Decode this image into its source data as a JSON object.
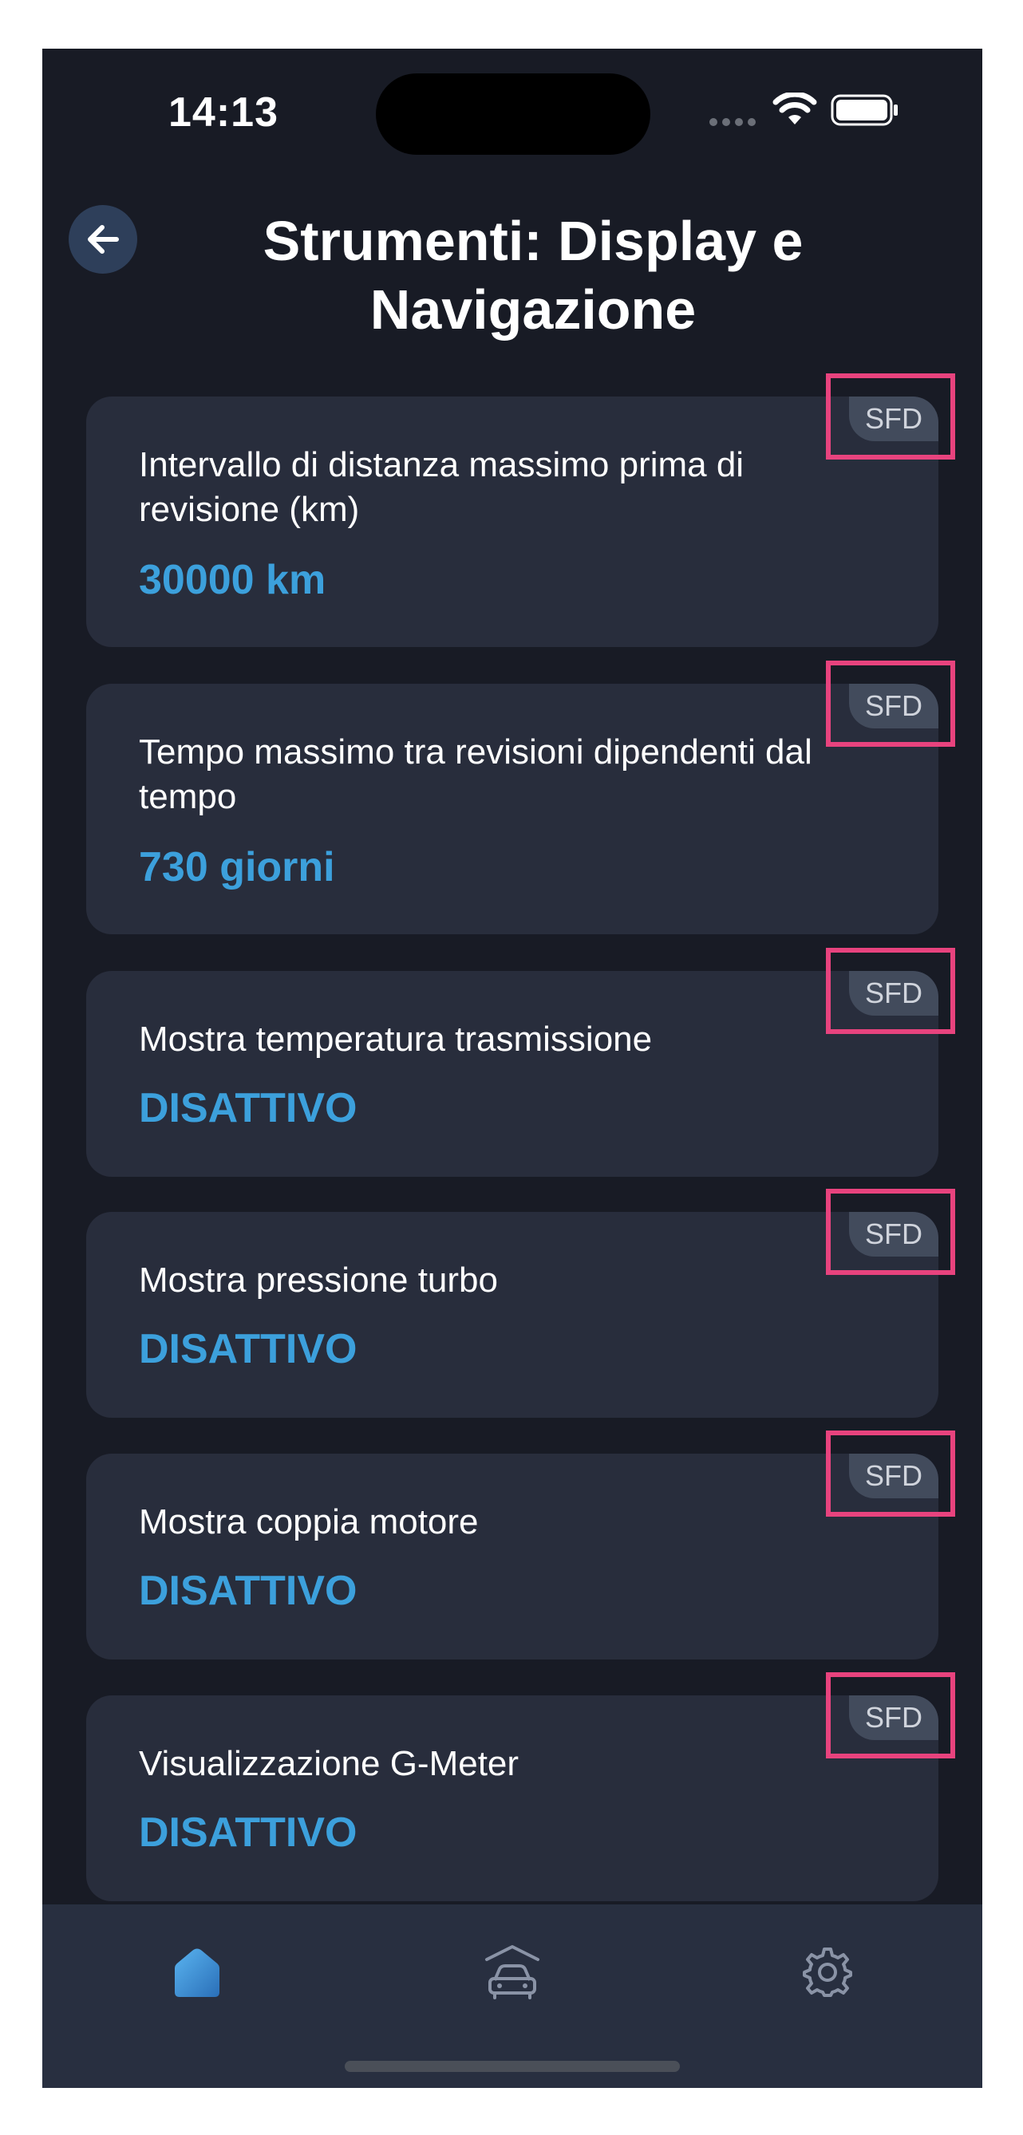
{
  "status_bar": {
    "time": "14:13"
  },
  "header": {
    "title": "Strumenti: Display e Navigazione",
    "back_icon": "arrow-left-icon"
  },
  "settings": [
    {
      "label": "Intervallo di distanza massimo prima di revisione (km)",
      "value": "30000 km",
      "badge": "SFD"
    },
    {
      "label": "Tempo massimo tra revisioni dipendenti dal tempo",
      "value": "730 giorni",
      "badge": "SFD"
    },
    {
      "label": "Mostra temperatura trasmissione",
      "value": "DISATTIVO",
      "badge": "SFD"
    },
    {
      "label": "Mostra pressione turbo",
      "value": "DISATTIVO",
      "badge": "SFD"
    },
    {
      "label": "Mostra coppia motore",
      "value": "DISATTIVO",
      "badge": "SFD"
    },
    {
      "label": "Visualizzazione G-Meter",
      "value": "DISATTIVO",
      "badge": "SFD"
    }
  ],
  "tab_bar": {
    "tabs": [
      {
        "icon": "home-icon",
        "active": true
      },
      {
        "icon": "car-garage-icon",
        "active": false
      },
      {
        "icon": "gear-icon",
        "active": false
      }
    ]
  },
  "colors": {
    "background": "#181b25",
    "card": "#282d3c",
    "accent": "#3ca0dc",
    "highlight": "#e8437e",
    "badge": "#424b5c"
  }
}
